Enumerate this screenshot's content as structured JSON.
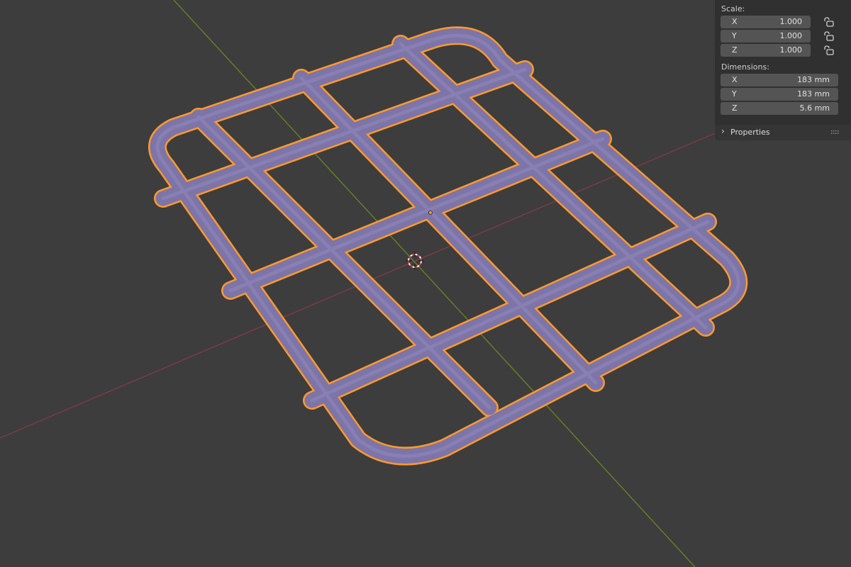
{
  "viewport": {
    "background": "#3d3d3d",
    "x_axis_color": "#8b3a46",
    "y_axis_color": "#6b8e23",
    "mesh_face_color": "#7d74a8",
    "selection_outline_color": "#ff9a2b",
    "object": "grid-frame-mesh",
    "overlays": [
      "3d-cursor-icon",
      "origin-dot"
    ]
  },
  "npanel": {
    "scale": {
      "label": "Scale:",
      "rows": [
        {
          "axis": "X",
          "value": "1.000",
          "lock_icon": "unlocked-icon"
        },
        {
          "axis": "Y",
          "value": "1.000",
          "lock_icon": "unlocked-icon"
        },
        {
          "axis": "Z",
          "value": "1.000",
          "lock_icon": "unlocked-icon"
        }
      ]
    },
    "dimensions": {
      "label": "Dimensions:",
      "rows": [
        {
          "axis": "X",
          "value": "183 mm"
        },
        {
          "axis": "Y",
          "value": "183 mm"
        },
        {
          "axis": "Z",
          "value": "5.6 mm"
        }
      ]
    },
    "properties": {
      "label": "Properties",
      "chevron_icon": "chevron-right-icon",
      "grip_icon": "drag-handle-icon"
    }
  }
}
